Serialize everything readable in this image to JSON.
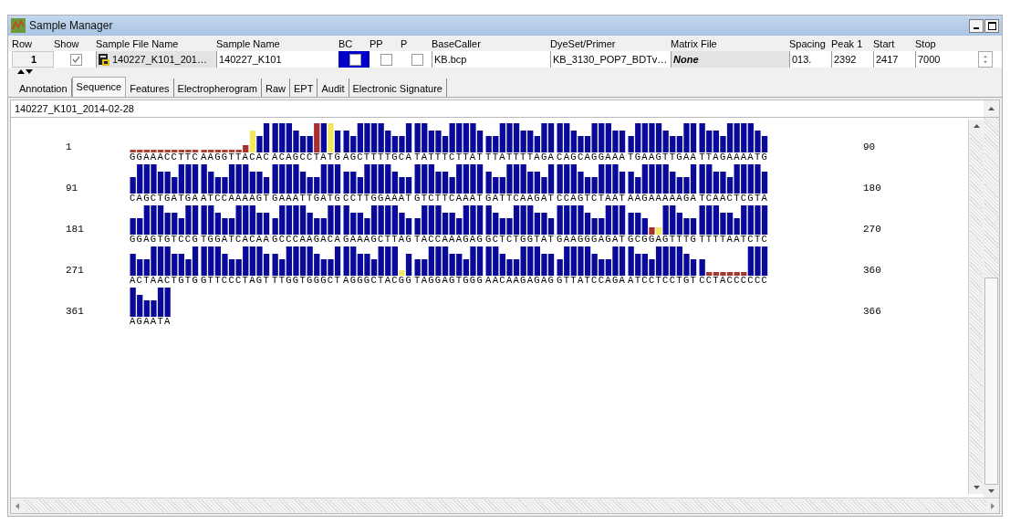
{
  "window": {
    "title": "Sample Manager"
  },
  "table": {
    "columns": [
      "Row",
      "Show",
      "Sample File Name",
      "Sample Name",
      "BC",
      "PP",
      "P",
      "BaseCaller",
      "DyeSet/Primer",
      "Matrix File",
      "Spacing",
      "Peak 1",
      "Start",
      "Stop"
    ],
    "row": {
      "row": "1",
      "show": {
        "checked": true
      },
      "sample_file_name": "140227_K101_201…",
      "sample_name": "140227_K101",
      "bc": {
        "checked": false,
        "selected": true
      },
      "pp": {
        "checked": false
      },
      "p": {
        "checked": false
      },
      "basecaller": "KB.bcp",
      "dyeset_primer": "KB_3130_POP7_BDTv…",
      "matrix_file": "None",
      "spacing": "013.",
      "peak_1": "2392",
      "start": "2417",
      "stop": "7000"
    }
  },
  "tabs": [
    {
      "label": "Annotation",
      "selected": false
    },
    {
      "label": "Sequence",
      "selected": true
    },
    {
      "label": "Features",
      "selected": false
    },
    {
      "label": "Electropherogram",
      "selected": false
    },
    {
      "label": "Raw",
      "selected": false
    },
    {
      "label": "EPT",
      "selected": false
    },
    {
      "label": "Audit",
      "selected": false
    },
    {
      "label": "Electronic Signature",
      "selected": false
    }
  ],
  "sequence": {
    "sample_label": "140227_K101_2014-02-28",
    "rows": [
      {
        "start": "1",
        "end": "90",
        "blocks": [
          "GGAAACCTTC",
          "AAGGTTACAC",
          "ACAGCCTATG",
          "AGCTTTTGCA",
          "TATTTCTTAT",
          "TTATTTTAGA",
          "CAGCAGGAAA",
          "TGAAGTTGAA",
          "TTAGAAAATG"
        ]
      },
      {
        "start": "91",
        "end": "180",
        "blocks": [
          "CAGCTGATGA",
          "ATCCAAAAGT",
          "GAAATTGATG",
          "CCTTGGAAAT",
          "GTCTTCAAAT",
          "GATTCAAGAT",
          "CCAGTCTAAT",
          "AAGAAAAAGA",
          "TCAACTCGTA"
        ]
      },
      {
        "start": "181",
        "end": "270",
        "blocks": [
          "GGAGTGTCCG",
          "TGGATCACAA",
          "GCCCAAGACA",
          "GAAAGCTTAG",
          "TACCAAAGAG",
          "GCTCTGGTAT",
          "GAAGGGAGAT",
          "GCGGAGTTTG",
          "TTTTAATCTC"
        ]
      },
      {
        "start": "271",
        "end": "360",
        "blocks": [
          "ACTAACTGTG",
          "GTTCCCTAGT",
          "TTGGTGGGCT",
          "AGGGCTACGG",
          "TAGGAGTGGG",
          "AACAAGAGAG",
          "GTTATCCAGA",
          "ATCCTCCTGT",
          "CCTACCCCCC"
        ]
      },
      {
        "start": "361",
        "end": "366",
        "blocks": [
          "AGAATA"
        ]
      }
    ]
  }
}
